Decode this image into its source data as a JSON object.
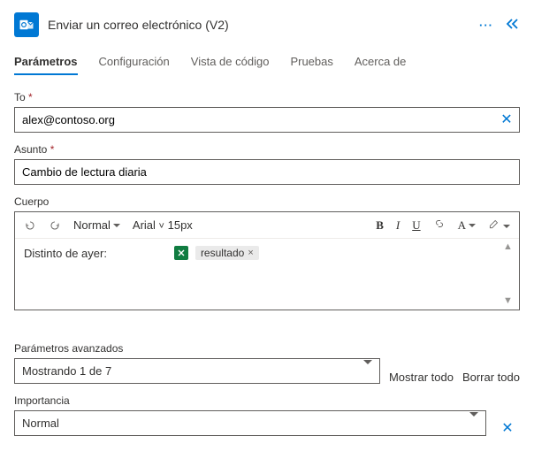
{
  "header": {
    "title": "Enviar un correo electrónico (V2)"
  },
  "tabs": {
    "params": "Parámetros",
    "config": "Configuración",
    "code": "Vista de código",
    "tests": "Pruebas",
    "about": "Acerca de"
  },
  "fields": {
    "to": {
      "label": "To",
      "value": "alex@contoso.org"
    },
    "subject": {
      "label": "Asunto",
      "value": "Cambio de lectura diaria"
    },
    "body": {
      "label": "Cuerpo",
      "heading_sel": "Normal",
      "font_sel": "Arial",
      "size_sel": "15px",
      "text_prefix": "Distinto de ayer:",
      "token": "resultado"
    }
  },
  "advanced": {
    "label": "Parámetros avanzados",
    "value": "Mostrando 1 de 7",
    "show_all": "Mostrar todo",
    "clear_all": "Borrar todo"
  },
  "importance": {
    "label": "Importancia",
    "value": "Normal"
  }
}
